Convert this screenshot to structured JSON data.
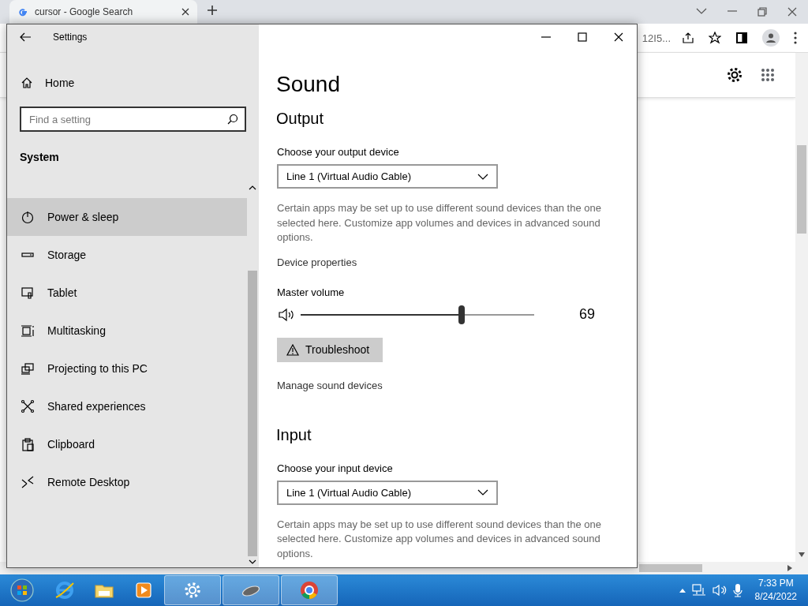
{
  "browser": {
    "tab": {
      "title": "cursor - Google Search"
    },
    "address_fragment": "12I5..."
  },
  "settings": {
    "title": "Settings",
    "home": "Home",
    "search": {
      "placeholder": "Find a setting"
    },
    "section": "System",
    "nav": [
      {
        "label": "Power & sleep",
        "selected": true
      },
      {
        "label": "Storage",
        "selected": false
      },
      {
        "label": "Tablet",
        "selected": false
      },
      {
        "label": "Multitasking",
        "selected": false
      },
      {
        "label": "Projecting to this PC",
        "selected": false
      },
      {
        "label": "Shared experiences",
        "selected": false
      },
      {
        "label": "Clipboard",
        "selected": false
      },
      {
        "label": "Remote Desktop",
        "selected": false
      }
    ],
    "page_title": "Sound",
    "output": {
      "heading": "Output",
      "device_label": "Choose your output device",
      "device": "Line 1 (Virtual Audio Cable)",
      "note": "Certain apps may be set up to use different sound devices than the one selected here. Customize app volumes and devices in advanced sound options.",
      "properties_link": "Device properties",
      "volume_label": "Master volume",
      "volume": {
        "level": 0.69,
        "reading": "69"
      },
      "troubleshoot": "Troubleshoot",
      "manage_link": "Manage sound devices"
    },
    "input": {
      "heading": "Input",
      "device_label": "Choose your input device",
      "device": "Line 1 (Virtual Audio Cable)",
      "note": "Certain apps may be set up to use different sound devices than the one selected here. Customize app volumes and devices in advanced sound options."
    }
  },
  "taskbar": {
    "apps": [
      {
        "open": false
      },
      {
        "open": false
      },
      {
        "open": false
      },
      {
        "open": false
      },
      {
        "open": true
      },
      {
        "open": true
      },
      {
        "open": true
      }
    ],
    "time": "7:33 PM",
    "date": "8/24/2022"
  }
}
